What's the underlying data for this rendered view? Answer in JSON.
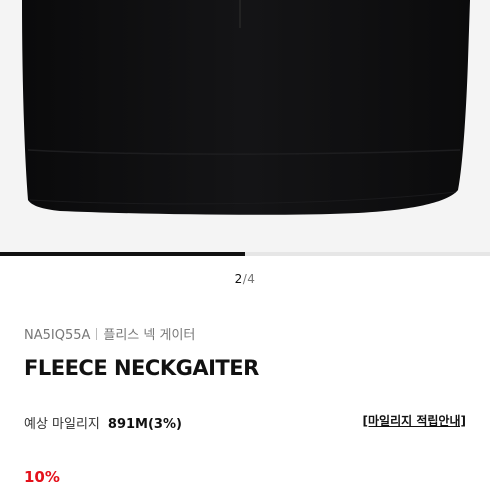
{
  "gallery": {
    "current": "2",
    "total": "4",
    "progress": 0.5,
    "image_alt": "black fleece neck gaiter close-up"
  },
  "product": {
    "code": "NA5IQ55A",
    "name_kr": "플리스 넥 게이터",
    "title": "FLEECE NECKGAITER"
  },
  "mileage": {
    "label": "예상 마일리지",
    "value": "891M(3%)",
    "guide_link": "[마일리지 적립안내]"
  },
  "price": {
    "discount": "10%"
  },
  "colors": {
    "product": "#0b0b0c",
    "background": "#f4f4f4",
    "discount": "#e4111b"
  }
}
